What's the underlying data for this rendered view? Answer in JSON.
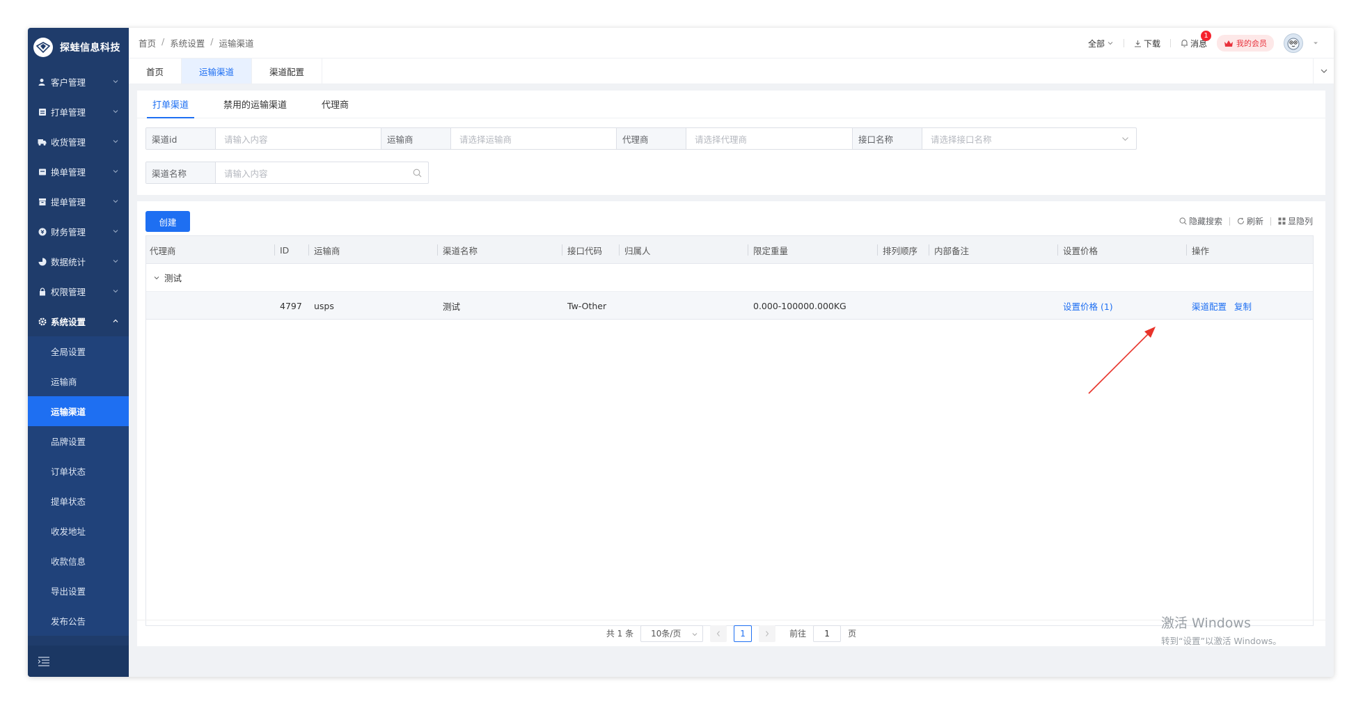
{
  "app": {
    "name": "探蛙信息科技"
  },
  "sidebar": {
    "items": [
      {
        "label": "客户管理",
        "icon": "user-icon"
      },
      {
        "label": "打单管理",
        "icon": "print-icon"
      },
      {
        "label": "收货管理",
        "icon": "truck-icon"
      },
      {
        "label": "换单管理",
        "icon": "swap-icon"
      },
      {
        "label": "提单管理",
        "icon": "box-icon"
      },
      {
        "label": "财务管理",
        "icon": "finance-icon"
      },
      {
        "label": "数据统计",
        "icon": "chart-icon"
      },
      {
        "label": "权限管理",
        "icon": "lock-icon"
      },
      {
        "label": "系统设置",
        "icon": "gear-icon"
      }
    ],
    "submenu": [
      "全局设置",
      "运输商",
      "运输渠道",
      "品牌设置",
      "订单状态",
      "提单状态",
      "收发地址",
      "收款信息",
      "导出设置",
      "发布公告"
    ]
  },
  "header": {
    "breadcrumb": [
      "首页",
      "系统设置",
      "运输渠道"
    ],
    "scope": "全部",
    "download": "下载",
    "messages": "消息",
    "message_count": "1",
    "vip": "我的会员"
  },
  "tags": [
    "首页",
    "运输渠道",
    "渠道配置"
  ],
  "subtabs": [
    "打单渠道",
    "禁用的运输渠道",
    "代理商"
  ],
  "filters": {
    "channel_id": {
      "label": "渠道id",
      "placeholder": "请输入内容"
    },
    "carrier": {
      "label": "运输商",
      "placeholder": "请选择运输商"
    },
    "agent": {
      "label": "代理商",
      "placeholder": "请选择代理商"
    },
    "api_name": {
      "label": "接口名称",
      "placeholder": "请选择接口名称"
    },
    "channel_name": {
      "label": "渠道名称",
      "placeholder": "请输入内容"
    }
  },
  "toolbar": {
    "create": "创建",
    "hide_search": "隐藏搜索",
    "refresh": "刷新",
    "columns": "显隐列"
  },
  "table": {
    "headers": [
      "代理商",
      "ID",
      "运输商",
      "渠道名称",
      "接口代码",
      "归属人",
      "限定重量",
      "排列顺序",
      "内部备注",
      "设置价格",
      "操作"
    ],
    "group": "测试",
    "row": {
      "agent": "",
      "id": "4797",
      "carrier": "usps",
      "channel_name": "测试",
      "api_code": "Tw-Other",
      "owner": "",
      "weight": "0.000-100000.000KG",
      "order": "",
      "note": "",
      "price": "设置价格 (1)",
      "action_config": "渠道配置",
      "action_copy": "复制"
    }
  },
  "pagination": {
    "total": "共 1 条",
    "page_size": "10条/页",
    "current": "1",
    "goto_label": "前往",
    "goto_value": "1",
    "page_unit": "页"
  },
  "watermark": {
    "line1": "激活 Windows",
    "line2": "转到“设置”以激活 Windows。"
  },
  "colors": {
    "primary": "#1e6ff2",
    "sidebar": "#1f3c6b",
    "annotation": "#e8332a"
  }
}
